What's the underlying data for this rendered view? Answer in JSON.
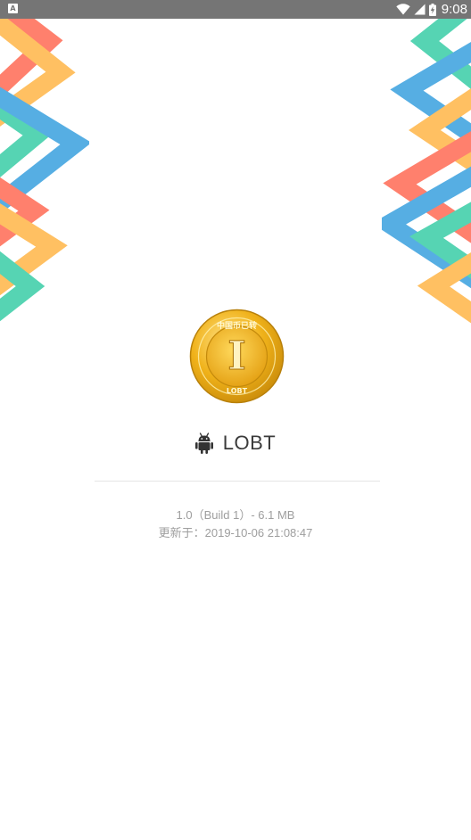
{
  "status_bar": {
    "left_badge": "A",
    "time": "9:08",
    "icons": [
      "wifi-icon",
      "signal-icon",
      "battery-charging-icon"
    ]
  },
  "app": {
    "name": "LOBT",
    "coin_top_text": "中国币已转",
    "coin_center_letter": "I",
    "coin_bottom_text": "LOBT",
    "platform_icon": "android-icon"
  },
  "meta": {
    "version_line": "1.0（Build 1）- 6.1 MB",
    "updated_line": "更新于：2019-10-06 21:08:47"
  },
  "colors": {
    "status_bar": "#757575",
    "coral": "#FF6F59",
    "orange": "#FFB84D",
    "teal": "#3FCFA9",
    "blue": "#3FA3E0",
    "gold": "#F0B21A",
    "text_dark": "#3b3b3b",
    "text_muted": "#9e9e9e"
  }
}
